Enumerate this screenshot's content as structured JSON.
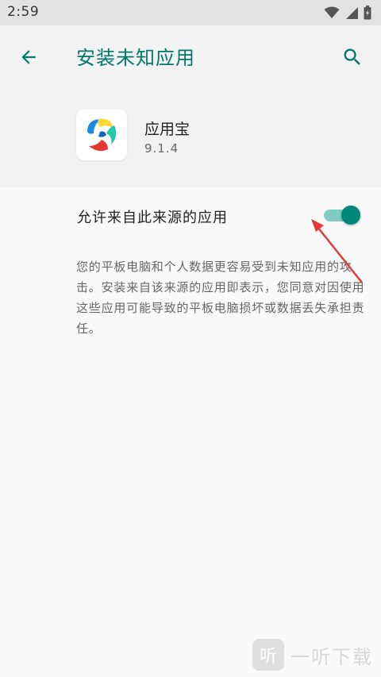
{
  "status_bar": {
    "time": "2:59",
    "icons": [
      "wifi-icon",
      "signal-icon",
      "battery-icon"
    ]
  },
  "app_bar": {
    "title": "安装未知应用",
    "back_icon": "arrow-back-icon",
    "search_icon": "search-icon"
  },
  "app_info": {
    "name": "应用宝",
    "version": "9.1.4"
  },
  "preference": {
    "label": "允许来自此来源的应用",
    "enabled": true
  },
  "warning_text": "您的平板电脑和个人数据更容易受到未知应用的攻击。安装来自该来源的应用即表示，您同意对因使用这些应用可能导致的平板电脑损坏或数据丢失承担责任。",
  "watermark": {
    "logo_glyph": "听",
    "text": "一听下载"
  },
  "colors": {
    "accent": "#00796b",
    "toggle_thumb": "#00897b",
    "toggle_track": "#80cbc4",
    "annotation": "#e53935",
    "background": "#fafafa",
    "header_bg": "#f2f2f2"
  }
}
